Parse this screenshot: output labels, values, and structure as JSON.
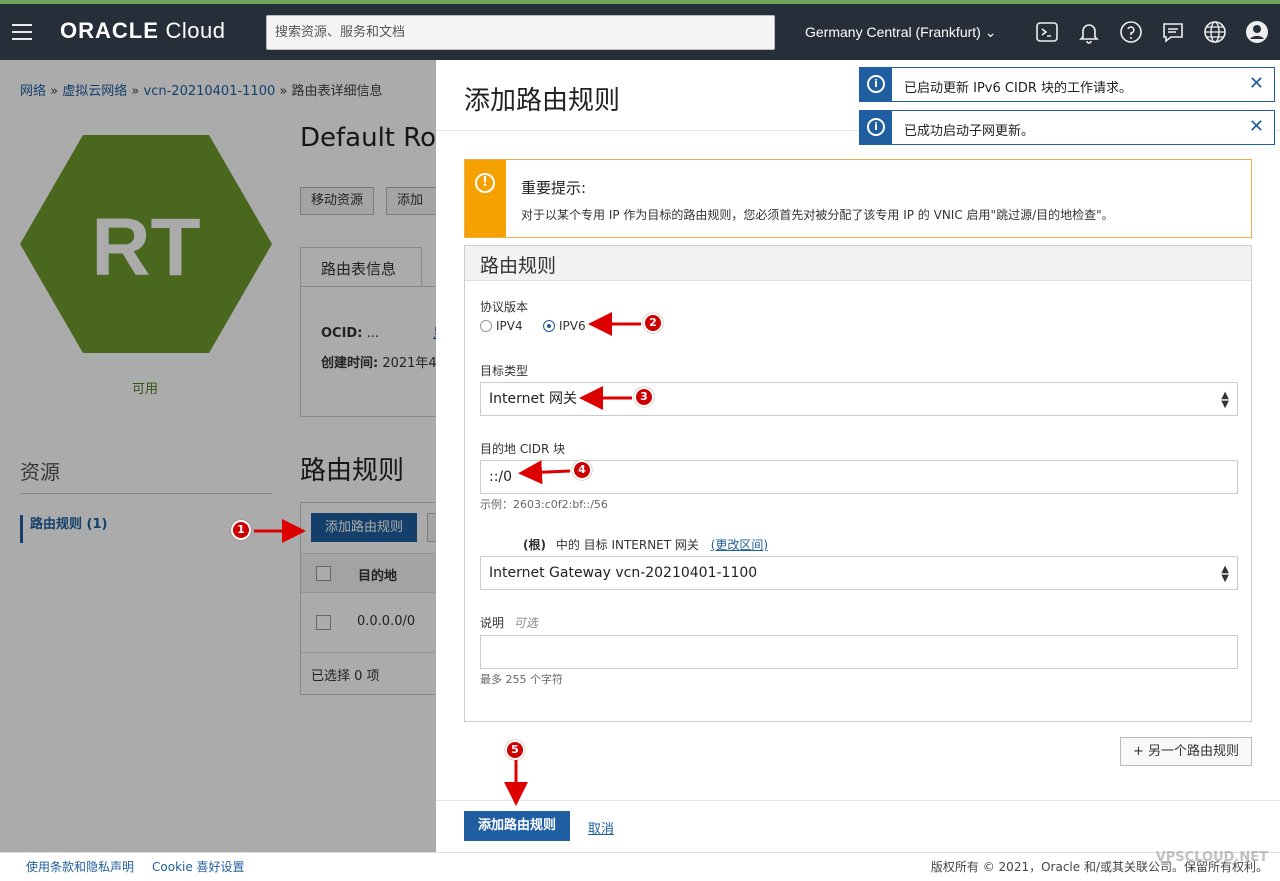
{
  "header": {
    "logo_main": "ORACLE",
    "logo_sub": "Cloud",
    "search_placeholder": "搜索资源、服务和文档",
    "region": "Germany Central (Frankfurt)",
    "icons": [
      "menu-icon",
      "terminal-icon",
      "bell-icon",
      "help-icon",
      "chat-icon",
      "globe-icon",
      "user-icon"
    ]
  },
  "breadcrumb": {
    "items": [
      "网络",
      "虚拟云网络",
      "vcn-20210401-1100"
    ],
    "current": "路由表详细信息",
    "separator": "»"
  },
  "background": {
    "hex_label": "RT",
    "hex_color": "#6f9a2e",
    "status": "可用",
    "resources_title": "资源",
    "resources_item": "路由规则 (1)",
    "page_title": "Default Rou",
    "move_button": "移动资源",
    "add_tag_button": "添加标",
    "tab_label": "路由表信息",
    "ocid_label": "OCID:",
    "ocid_value": "...",
    "show_link": "显",
    "created_label": "创建时间:",
    "created_value": "2021年4",
    "rules_title": "路由规则",
    "add_rule_button": "添加路由规则",
    "col_destination": "目的地",
    "row_destination": "0.0.0.0/0",
    "selected_text": "已选择 0 项"
  },
  "panel": {
    "title": "添加路由规则",
    "notice_title": "重要提示:",
    "notice_text": "对于以某个专用 IP 作为目标的路由规则，您必须首先对被分配了该专用 IP 的 VNIC 启用\"跳过源/目的地检查\"。",
    "rule_section_title": "路由规则",
    "protocol_label": "协议版本",
    "ipv4_label": "IPV4",
    "ipv6_label": "IPV6",
    "protocol_selected": "IPV6",
    "target_type_label": "目标类型",
    "target_type_value": "Internet 网关",
    "cidr_label": "目的地 CIDR 块",
    "cidr_value": "::/0",
    "cidr_example": "示例：2603:c0f2:bf::/56",
    "compartment_prefix": "(根)",
    "compartment_text": "中的 目标 INTERNET 网关",
    "compartment_link": "(更改区间)",
    "gateway_value": "Internet Gateway vcn-20210401-1100",
    "desc_label": "说明",
    "desc_optional": "可选",
    "desc_value": "",
    "desc_hint": "最多 255 个字符",
    "another_button": "+ 另一个路由规则",
    "add_button": "添加路由规则",
    "cancel_link": "取消"
  },
  "toasts": [
    {
      "text": "已启动更新 IPv6 CIDR 块的工作请求。"
    },
    {
      "text": "已成功启动子网更新。"
    }
  ],
  "markers": [
    "1",
    "2",
    "3",
    "4",
    "5"
  ],
  "footer": {
    "terms": "使用条款和隐私声明",
    "cookie": "Cookie 喜好设置",
    "copyright": "版权所有 © 2021，Oracle 和/或其关联公司。保留所有权利。",
    "watermark": "VPSCLOUD.NET"
  },
  "colors": {
    "topbar": "#262e3a",
    "accent_blue": "#1f5ea0",
    "notice_orange": "#f5a200",
    "marker_red": "#cc0000"
  }
}
